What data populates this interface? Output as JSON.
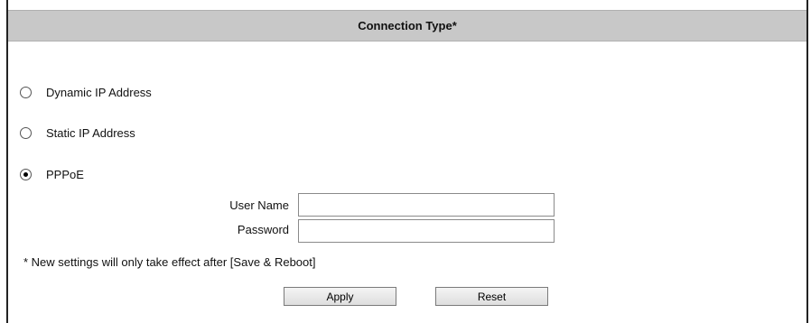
{
  "header": {
    "title": "Connection Type*"
  },
  "connection_options": [
    {
      "label": "Dynamic IP Address",
      "selected": false
    },
    {
      "label": "Static IP Address",
      "selected": false
    },
    {
      "label": "PPPoE",
      "selected": true
    }
  ],
  "pppoe": {
    "username_label": "User Name",
    "username_value": "",
    "password_label": "Password",
    "password_value": ""
  },
  "note": "* New settings will only take effect after [Save & Reboot]",
  "actions": {
    "apply_label": "Apply",
    "reset_label": "Reset"
  }
}
